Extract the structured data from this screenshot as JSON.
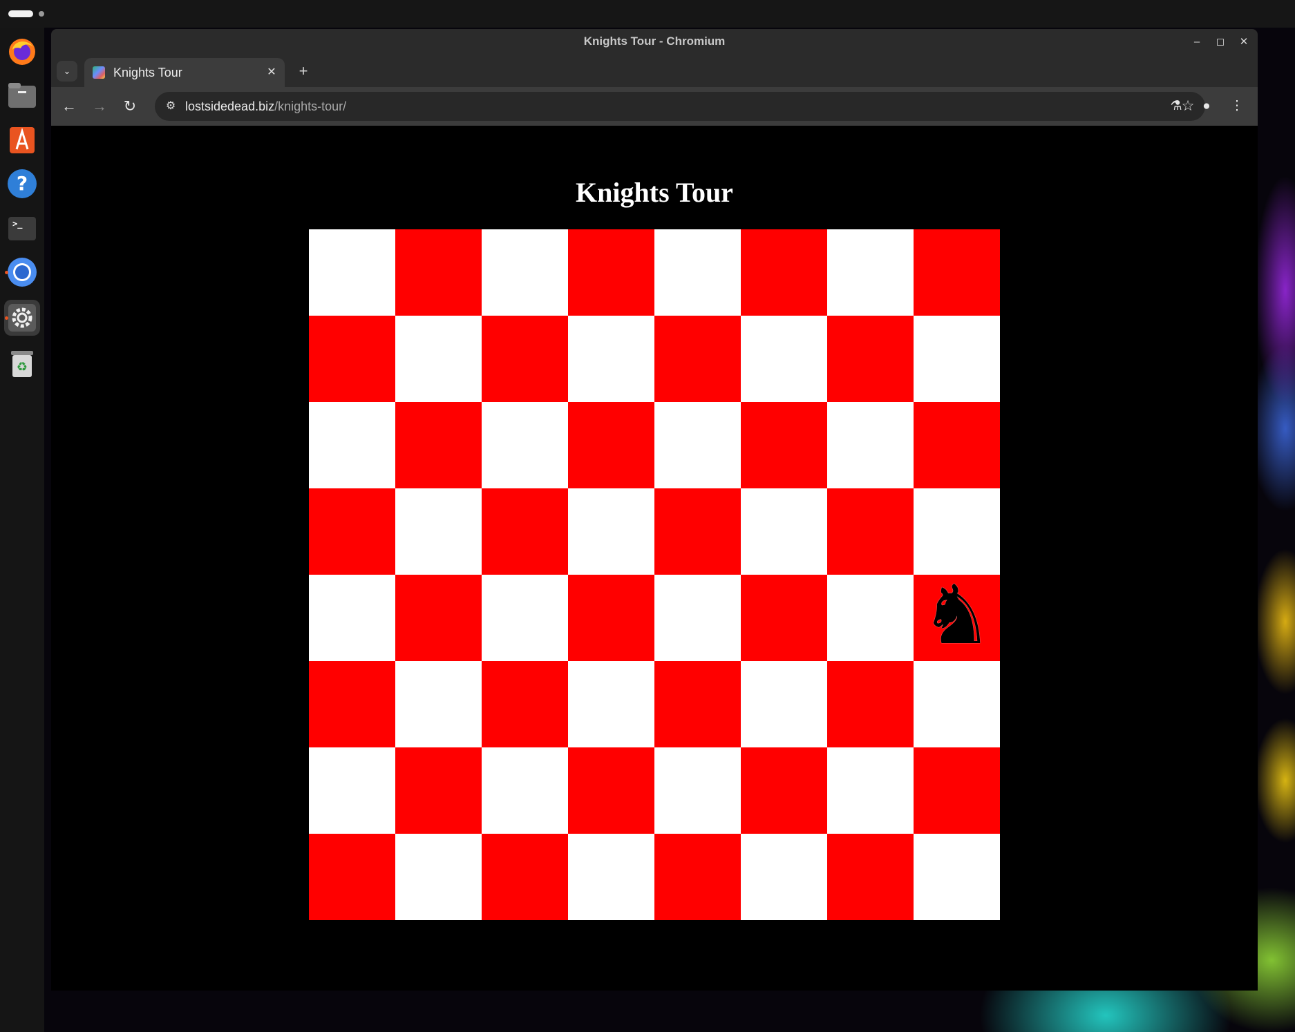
{
  "window": {
    "title": "Knights Tour - Chromium"
  },
  "tabs": [
    {
      "title": "Knights Tour",
      "active": true
    }
  ],
  "address_bar": {
    "host": "lostsidedead.biz",
    "path": "/knights-tour/"
  },
  "page": {
    "heading": "Knights Tour",
    "board": {
      "size": 8,
      "light_color": "#ffffff",
      "dark_color": "#ff0000",
      "knight": {
        "row": 4,
        "col": 7,
        "glyph": "♞"
      }
    }
  },
  "dock": {
    "apps": [
      {
        "name": "firefox-icon"
      },
      {
        "name": "files-icon"
      },
      {
        "name": "app-center-icon"
      },
      {
        "name": "help-icon"
      },
      {
        "name": "terminal-icon"
      },
      {
        "name": "chromium-icon"
      },
      {
        "name": "settings-icon"
      },
      {
        "name": "trash-icon"
      }
    ]
  }
}
